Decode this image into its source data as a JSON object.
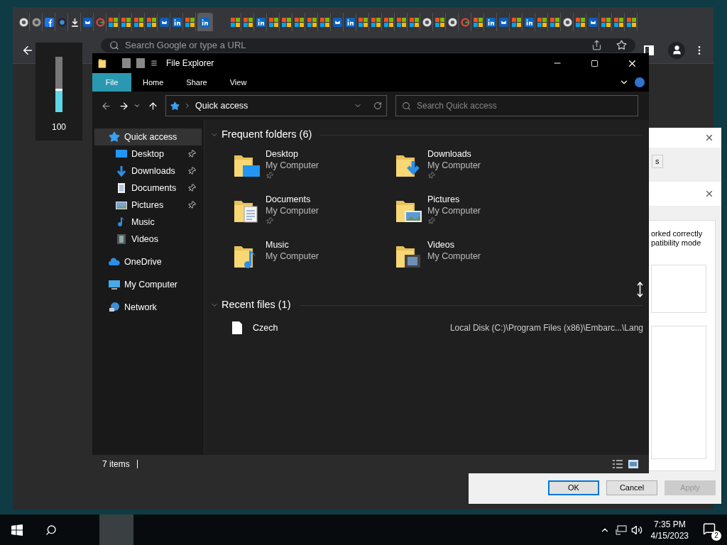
{
  "browser": {
    "tabs": [
      {
        "kind": "chrome",
        "selected": false
      },
      {
        "kind": "chrome-grey",
        "selected": false
      },
      {
        "kind": "facebook",
        "selected": false
      },
      {
        "kind": "lens",
        "selected": false
      },
      {
        "kind": "download",
        "selected": false
      },
      {
        "kind": "outlook",
        "selected": false
      },
      {
        "kind": "gmail",
        "selected": false
      },
      {
        "kind": "ms",
        "selected": false
      },
      {
        "kind": "ms",
        "selected": false
      },
      {
        "kind": "ms",
        "selected": false
      },
      {
        "kind": "ms",
        "selected": false
      },
      {
        "kind": "outlook",
        "selected": false
      },
      {
        "kind": "linkedin",
        "selected": false
      },
      {
        "kind": "ms",
        "selected": false
      },
      {
        "kind": "linkedin",
        "selected": true
      },
      {
        "kind": "ms",
        "selected": false
      },
      {
        "kind": "ms",
        "selected": false
      },
      {
        "kind": "linkedin",
        "selected": false
      },
      {
        "kind": "ms",
        "selected": false
      },
      {
        "kind": "ms",
        "selected": false
      },
      {
        "kind": "ms",
        "selected": false
      },
      {
        "kind": "ms",
        "selected": false
      },
      {
        "kind": "ms",
        "selected": false
      },
      {
        "kind": "outlook",
        "selected": false
      },
      {
        "kind": "linkedin",
        "selected": false
      },
      {
        "kind": "ms",
        "selected": false
      },
      {
        "kind": "ms",
        "selected": false
      },
      {
        "kind": "ms",
        "selected": false
      },
      {
        "kind": "ms",
        "selected": false
      },
      {
        "kind": "ms",
        "selected": false
      },
      {
        "kind": "chrome",
        "selected": false
      },
      {
        "kind": "ms",
        "selected": false
      },
      {
        "kind": "chrome",
        "selected": false
      },
      {
        "kind": "gmail",
        "selected": false
      },
      {
        "kind": "ms",
        "selected": false
      },
      {
        "kind": "linkedin",
        "selected": false
      },
      {
        "kind": "outlook",
        "selected": false
      },
      {
        "kind": "ms",
        "selected": false
      },
      {
        "kind": "linkedin",
        "selected": false
      },
      {
        "kind": "ms",
        "selected": false
      },
      {
        "kind": "ms",
        "selected": false
      },
      {
        "kind": "chrome",
        "selected": false
      },
      {
        "kind": "ms",
        "selected": false
      },
      {
        "kind": "outlook",
        "selected": false
      },
      {
        "kind": "ms",
        "selected": false
      },
      {
        "kind": "ms",
        "selected": false
      },
      {
        "kind": "ms",
        "selected": false
      }
    ],
    "address_placeholder": "Search Google or type a URL"
  },
  "volume_flyout": {
    "level": 0.42,
    "reading": "100"
  },
  "explorer": {
    "title": "File Explorer",
    "ribbon_tabs": [
      {
        "label": "File",
        "selected": true
      },
      {
        "label": "Home",
        "selected": false
      },
      {
        "label": "Share",
        "selected": false
      },
      {
        "label": "View",
        "selected": false
      }
    ],
    "address": "Quick access",
    "search_placeholder": "Search Quick access",
    "nav": [
      {
        "label": "Quick access",
        "kind": "quick",
        "selected": true,
        "children": [
          {
            "label": "Desktop",
            "kind": "desktop",
            "pinned": true,
            "selected": false
          },
          {
            "label": "Downloads",
            "kind": "downloads",
            "pinned": true,
            "selected": false
          },
          {
            "label": "Documents",
            "kind": "documents",
            "pinned": true,
            "selected": false
          },
          {
            "label": "Pictures",
            "kind": "pictures",
            "pinned": true,
            "selected": false
          },
          {
            "label": "Music",
            "kind": "music",
            "pinned": false,
            "selected": false
          },
          {
            "label": "Videos",
            "kind": "videos",
            "pinned": false,
            "selected": false
          }
        ]
      },
      {
        "label": "OneDrive",
        "kind": "cloud",
        "selected": false
      },
      {
        "label": "My Computer",
        "kind": "computer",
        "selected": false
      },
      {
        "label": "Network",
        "kind": "network",
        "selected": false
      }
    ],
    "frequent_title": "Frequent folders (6)",
    "folders": [
      {
        "name": "Desktop",
        "location": "My Computer",
        "kind": "desktop",
        "pinned": true
      },
      {
        "name": "Downloads",
        "location": "My Computer",
        "kind": "downloads",
        "pinned": true
      },
      {
        "name": "Documents",
        "location": "My Computer",
        "kind": "documents",
        "pinned": true
      },
      {
        "name": "Pictures",
        "location": "My Computer",
        "kind": "pictures",
        "pinned": true
      },
      {
        "name": "Music",
        "location": "My Computer",
        "kind": "music",
        "pinned": false
      },
      {
        "name": "Videos",
        "location": "My Computer",
        "kind": "videos",
        "pinned": false
      }
    ],
    "recent_title": "Recent files (1)",
    "recent_files": [
      {
        "name": "Czech",
        "path": "Local Disk (C:)\\Program Files (x86)\\Embarc...\\Lang"
      }
    ],
    "status": "7 items"
  },
  "dialog": {
    "tab_fragment": "s",
    "lines": [
      "orked correctly",
      "patibility mode"
    ],
    "buttons": [
      {
        "label": "OK",
        "kind": "default",
        "disabled": false
      },
      {
        "label": "Cancel",
        "kind": "normal",
        "disabled": false
      },
      {
        "label": "Apply",
        "kind": "normal",
        "disabled": true
      }
    ]
  },
  "taskbar": {
    "time": "7:35 PM",
    "date": "4/15/2023",
    "notifications": "2"
  }
}
